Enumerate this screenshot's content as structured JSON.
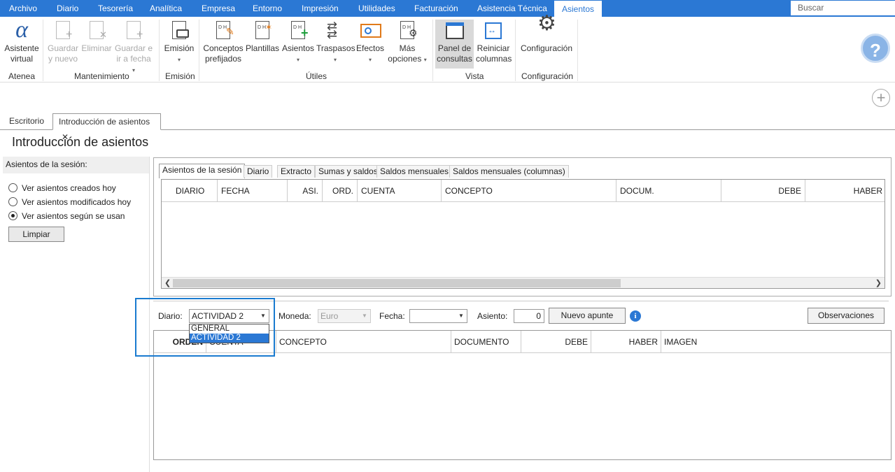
{
  "menu": {
    "tabs": [
      "Archivo",
      "Diario",
      "Tesorería",
      "Analítica",
      "Empresa",
      "Entorno",
      "Impresión",
      "Utilidades",
      "Facturación",
      "Asistencia Técnica",
      "Asientos"
    ],
    "active_tab": "Asientos",
    "search_placeholder": "Buscar"
  },
  "ribbon": {
    "groups": {
      "atenea": "Atenea",
      "mantenimiento": "Mantenimiento",
      "emision": "Emisión",
      "utiles": "Útiles",
      "vista": "Vista",
      "configuracion": "Configuración"
    },
    "buttons": {
      "asistente_1": "Asistente",
      "asistente_2": "virtual",
      "guardar_1": "Guardar",
      "guardar_2": "y nuevo",
      "eliminar_1": "Eliminar",
      "guardar_fecha_1": "Guardar e",
      "guardar_fecha_2": "ir a fecha",
      "emision_1": "Emisión",
      "conceptos_1": "Conceptos",
      "conceptos_2": "prefijados",
      "plantillas_1": "Plantillas",
      "asientos_1": "Asientos",
      "traspasos_1": "Traspasos",
      "efectos_1": "Efectos",
      "mas_1": "Más",
      "mas_2": "opciones",
      "panel_1": "Panel de",
      "panel_2": "consultas",
      "reiniciar_1": "Reiniciar",
      "reiniciar_2": "columnas",
      "configuracion_1": "Configuración"
    },
    "doc_icon_text": "D H"
  },
  "doc_tabs": {
    "escritorio": "Escritorio",
    "introduccion": "Introducción de asientos",
    "close_glyph": "✕"
  },
  "page_title": "Introducción de asientos",
  "session": {
    "header": "Asientos de la sesión:",
    "options": [
      "Ver asientos creados hoy",
      "Ver asientos modificados hoy",
      "Ver asientos según se usan"
    ],
    "selected_index": 2,
    "clear_button": "Limpiar"
  },
  "sub_tabs": [
    "Asientos de la sesión",
    "Diario",
    "Extracto",
    "Sumas y saldos",
    "Saldos mensuales",
    "Saldos mensuales (columnas)"
  ],
  "grid1_columns": [
    "DIARIO",
    "FECHA",
    "ASI.",
    "ORD.",
    "CUENTA",
    "CONCEPTO",
    "DOCUM.",
    "DEBE",
    "HABER"
  ],
  "form": {
    "diario_label": "Diario:",
    "diario_value": "ACTIVIDAD 2",
    "diario_options": [
      "GENERAL",
      "ACTIVIDAD 2"
    ],
    "moneda_label": "Moneda:",
    "moneda_value": "Euro",
    "fecha_label": "Fecha:",
    "fecha_value": "",
    "asiento_label": "Asiento:",
    "asiento_value": "0",
    "nuevo_apunte": "Nuevo apunte",
    "observaciones": "Observaciones",
    "info_glyph": "i"
  },
  "grid2_columns": [
    "ORDEN",
    "CUENTA",
    "CONCEPTO",
    "DOCUMENTO",
    "DEBE",
    "HABER",
    "IMAGEN"
  ],
  "glyphs": {
    "help": "?",
    "add": "+",
    "alpha": "α",
    "caret": "▾",
    "dd_arrow": "▼",
    "left": "❮",
    "right": "❯"
  },
  "colors": {
    "accent": "#2b78d4",
    "highlight_border": "#1a7bd0"
  }
}
